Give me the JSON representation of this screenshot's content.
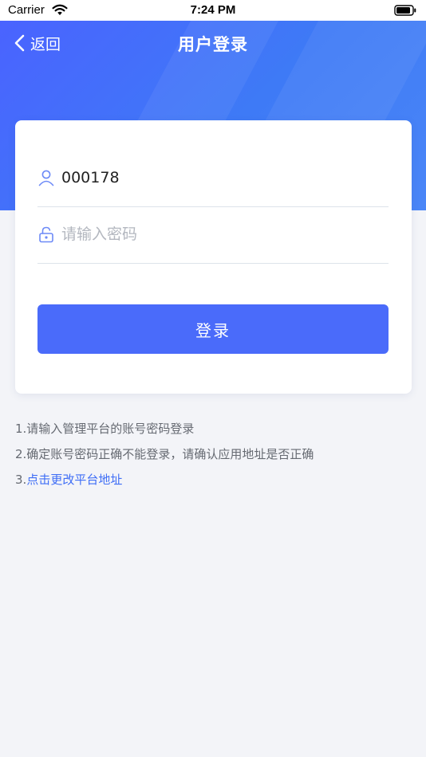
{
  "status_bar": {
    "carrier": "Carrier",
    "time": "7:24 PM"
  },
  "nav": {
    "back_label": "返回",
    "title": "用户登录"
  },
  "form": {
    "username_value": "000178",
    "password_placeholder": "请输入密码",
    "login_label": "登录"
  },
  "tips": {
    "line1": "1.请输入管理平台的账号密码登录",
    "line2": "2.确定账号密码正确不能登录，请确认应用地址是否正确",
    "line3_prefix": "3.",
    "line3_link": "点击更改平台地址"
  },
  "colors": {
    "header_gradient_start": "#4a63ff",
    "header_gradient_end": "#4a86f7",
    "primary": "#4a6bfa",
    "link": "#3f6ef6",
    "background": "#f3f4f8"
  },
  "icons": {
    "back": "chevron-left-icon",
    "user": "user-icon",
    "lock": "lock-icon",
    "wifi": "wifi-icon",
    "battery": "battery-icon"
  }
}
